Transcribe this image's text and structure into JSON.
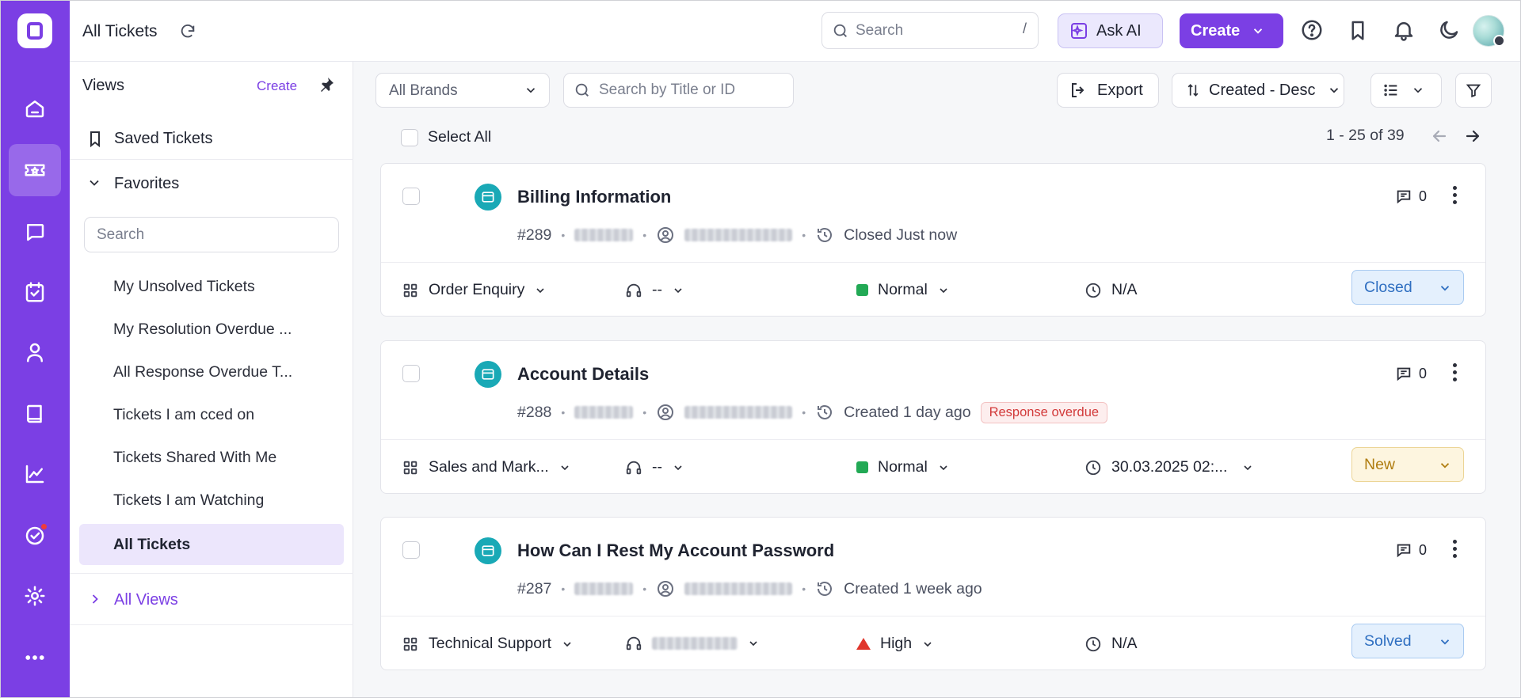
{
  "header": {
    "page_title": "All Tickets",
    "search_placeholder": "Search",
    "search_shortcut": "/",
    "ask_ai_label": "Ask AI",
    "create_label": "Create"
  },
  "rail": {
    "items": [
      "home-icon",
      "tickets-icon",
      "chat-icon",
      "tasks-icon",
      "contacts-icon",
      "knowledge-base-icon",
      "reports-icon",
      "approvals-icon",
      "settings-icon",
      "more-icon"
    ],
    "active": "tickets-icon",
    "accent_color": "#7b3fe4"
  },
  "views": {
    "title": "Views",
    "create_label": "Create",
    "saved_label": "Saved Tickets",
    "favorites_label": "Favorites",
    "search_placeholder": "Search",
    "items": [
      {
        "label": "My Unsolved Tickets"
      },
      {
        "label": "My Resolution Overdue ..."
      },
      {
        "label": "All Response Overdue T..."
      },
      {
        "label": "Tickets I am cced on"
      },
      {
        "label": "Tickets Shared With Me"
      },
      {
        "label": "Tickets I am Watching"
      },
      {
        "label": "All Tickets"
      }
    ],
    "active_item": "All Tickets",
    "all_views_label": "All Views"
  },
  "toolbar": {
    "brands_label": "All Brands",
    "title_search_placeholder": "Search by Title or ID",
    "export_label": "Export",
    "sort_label": "Created - Desc",
    "select_all_label": "Select All",
    "pagination": "1 - 25 of 39"
  },
  "tickets": [
    {
      "title": "Billing Information",
      "id": "#289",
      "status_text": "Closed Just now",
      "overdue_badge": "",
      "comments": "0",
      "category": "Order Enquiry",
      "agent": "--",
      "priority": "Normal",
      "due": "N/A",
      "status": "Closed"
    },
    {
      "title": "Account Details",
      "id": "#288",
      "status_text": "Created 1 day ago",
      "overdue_badge": "Response overdue",
      "comments": "0",
      "category": "Sales and Mark...",
      "agent": "--",
      "priority": "Normal",
      "due": "30.03.2025 02:...",
      "status": "New"
    },
    {
      "title": "How Can I Rest My Account Password",
      "id": "#287",
      "status_text": "Created 1 week ago",
      "overdue_badge": "",
      "comments": "0",
      "category": "Technical Support",
      "agent": "",
      "priority": "High",
      "due": "N/A",
      "status": "Solved"
    }
  ]
}
